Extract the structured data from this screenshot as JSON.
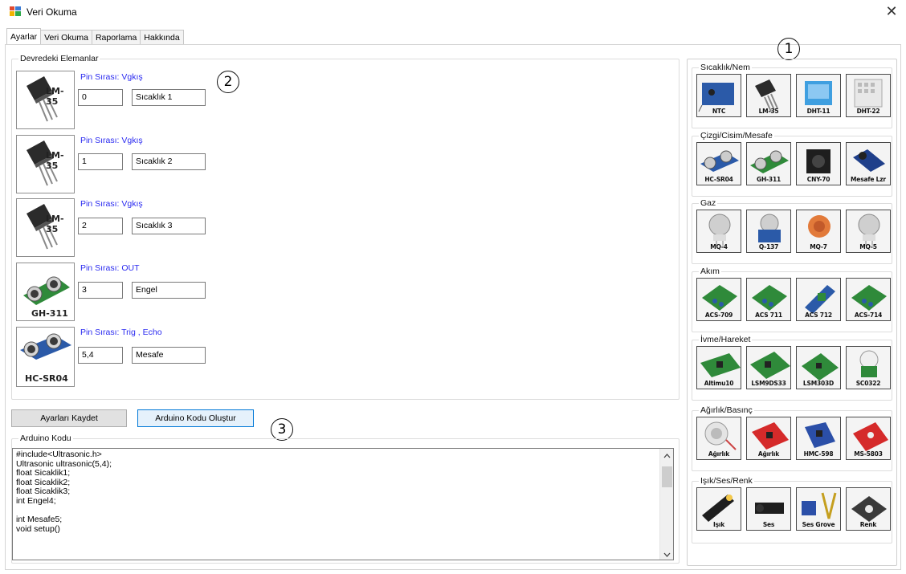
{
  "window": {
    "title": "Veri Okuma",
    "close_glyph": "✕"
  },
  "tabs": [
    "Ayarlar",
    "Veri Okuma",
    "Raporlama",
    "Hakkında"
  ],
  "annotations": [
    "1",
    "2",
    "3"
  ],
  "components_group": {
    "label": "Devredeki Elemanlar",
    "rows": [
      {
        "image_label": "LM-35",
        "pin": "Pin Sırası: Vgkış",
        "index": "0",
        "name": "Sıcaklık 1"
      },
      {
        "image_label": "LM-35",
        "pin": "Pin Sırası: Vgkış",
        "index": "1",
        "name": "Sıcaklık 2"
      },
      {
        "image_label": "LM-35",
        "pin": "Pin Sırası: Vgkış",
        "index": "2",
        "name": "Sıcaklık 3"
      },
      {
        "image_label": "GH-311",
        "pin": "Pin Sırası: OUT",
        "index": "3",
        "name": "Engel"
      },
      {
        "image_label": "HC-SR04",
        "pin": "Pin Sırası: Trig , Echo",
        "index": "5,4",
        "name": "Mesafe"
      }
    ]
  },
  "buttons": {
    "save": "Ayarları Kaydet",
    "generate": "Arduino Kodu Oluştur"
  },
  "code_group": {
    "label": "Arduino Kodu",
    "lines": [
      "#include<Ultrasonic.h>",
      "Ultrasonic ultrasonic(5,4);",
      "float Sicaklik1;",
      "float Sicaklik2;",
      "float Sicaklik3;",
      "int Engel4;",
      "",
      "int Mesafe5;",
      "void setup()"
    ]
  },
  "palette": [
    {
      "label": "Sıcaklık/Nem",
      "items": [
        {
          "caption": "NTC",
          "kind": "ntc"
        },
        {
          "caption": "LM-35",
          "kind": "lm35"
        },
        {
          "caption": "DHT-11",
          "kind": "dht11"
        },
        {
          "caption": "DHT-22",
          "kind": "dht22"
        }
      ]
    },
    {
      "label": "Çizgi/Cisim/Mesafe",
      "items": [
        {
          "caption": "HC-SR04",
          "kind": "hcsr04"
        },
        {
          "caption": "GH-311",
          "kind": "gh311"
        },
        {
          "caption": "CNY-70",
          "kind": "cny70"
        },
        {
          "caption": "Mesafe Lzr",
          "kind": "laser"
        }
      ]
    },
    {
      "label": "Gaz",
      "items": [
        {
          "caption": "MQ-4",
          "kind": "mq"
        },
        {
          "caption": "Q-137",
          "kind": "mq137"
        },
        {
          "caption": "MQ-7",
          "kind": "mq7"
        },
        {
          "caption": "MQ-5",
          "kind": "mq"
        }
      ]
    },
    {
      "label": "Akım",
      "items": [
        {
          "caption": "ACS-709",
          "kind": "acs"
        },
        {
          "caption": "ACS 711",
          "kind": "acs"
        },
        {
          "caption": "ACS 712",
          "kind": "acs712"
        },
        {
          "caption": "ACS-714",
          "kind": "acs"
        }
      ]
    },
    {
      "label": "İvme/Hareket",
      "items": [
        {
          "caption": "Altimu10",
          "kind": "imu"
        },
        {
          "caption": "LSM9DS33",
          "kind": "imu2"
        },
        {
          "caption": "LSM303D",
          "kind": "imu3"
        },
        {
          "caption": "SC0322",
          "kind": "pir"
        }
      ]
    },
    {
      "label": "Ağırlık/Basınç",
      "items": [
        {
          "caption": "Ağırlık",
          "kind": "load"
        },
        {
          "caption": "Ağırlık",
          "kind": "redboard"
        },
        {
          "caption": "HMC-598",
          "kind": "hmc"
        },
        {
          "caption": "MS-5803",
          "kind": "ms"
        }
      ]
    },
    {
      "label": "Işık/Ses/Renk",
      "items": [
        {
          "caption": "Işık",
          "kind": "light"
        },
        {
          "caption": "Ses",
          "kind": "sound"
        },
        {
          "caption": "Ses Grove",
          "kind": "grove"
        },
        {
          "caption": "Renk",
          "kind": "color"
        }
      ]
    }
  ]
}
